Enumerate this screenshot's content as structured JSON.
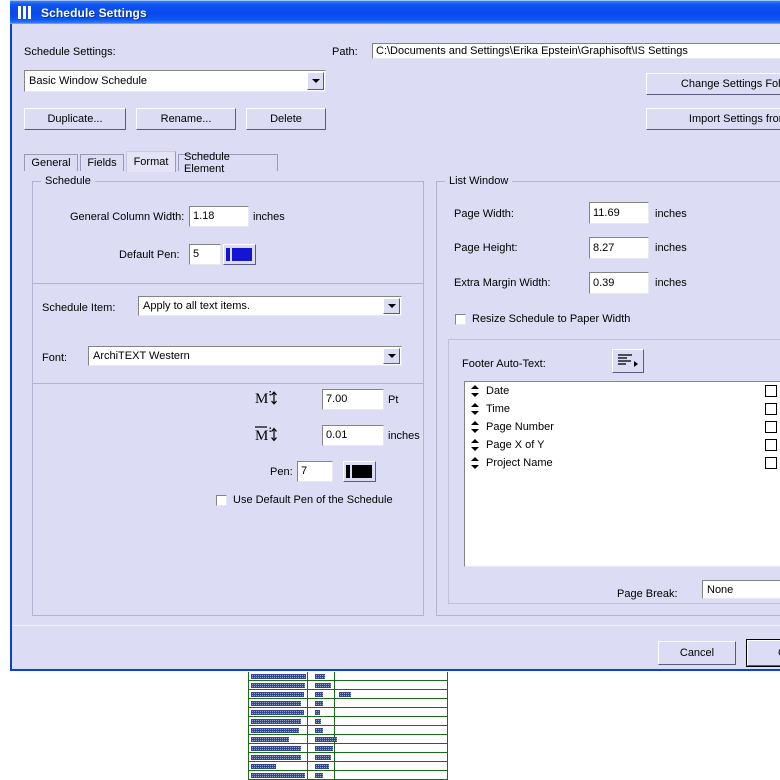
{
  "window": {
    "title": "Schedule Settings",
    "icon": "columns-icon"
  },
  "header": {
    "settings_label": "Schedule Settings:",
    "settings_value": "Basic Window Schedule",
    "path_label": "Path:",
    "path_value": "C:\\Documents and Settings\\Erika Epstein\\Graphisoft\\IS Settings",
    "buttons": {
      "duplicate": "Duplicate...",
      "rename": "Rename...",
      "delete": "Delete",
      "change_settings_folder": "Change Settings Folder...",
      "import_settings_from": "Import Settings from..."
    }
  },
  "tabs": [
    {
      "label": "General",
      "active": false
    },
    {
      "label": "Fields",
      "active": false
    },
    {
      "label": "Format",
      "active": true
    },
    {
      "label": "Schedule Element",
      "active": false
    }
  ],
  "schedule_group": {
    "title": "Schedule",
    "general_column_width_label": "General Column Width:",
    "general_column_width_value": "1.18",
    "general_column_width_unit": "inches",
    "default_pen_label": "Default Pen:",
    "default_pen_value": "5",
    "default_pen_color": "#1414d2",
    "schedule_item_label": "Schedule Item:",
    "schedule_item_value": "Apply to all text items.",
    "font_label": "Font:",
    "font_value": "ArchiTEXT Western",
    "font_size_icon": "text-size-icon",
    "font_size_value": "7.00",
    "font_size_unit": "Pt",
    "line_height_icon": "text-height-icon",
    "line_height_value": "0.01",
    "line_height_unit": "inches",
    "pen_label": "Pen:",
    "pen_value": "7",
    "pen_color": "#000000",
    "use_default_pen_label": "Use Default Pen of the Schedule",
    "use_default_pen_checked": false
  },
  "list_window_group": {
    "title": "List Window",
    "page_width_label": "Page Width:",
    "page_width_value": "11.69",
    "page_width_unit": "inches",
    "page_height_label": "Page Height:",
    "page_height_value": "8.27",
    "page_height_unit": "inches",
    "extra_margin_label": "Extra Margin Width:",
    "extra_margin_value": "0.39",
    "extra_margin_unit": "inches",
    "resize_label": "Resize Schedule to Paper Width",
    "resize_checked": false,
    "footer_autotext_label": "Footer Auto-Text:",
    "footer_autotext_button_icon": "text-align-left-menu-icon",
    "footer_items": [
      {
        "label": "Date",
        "checked": false
      },
      {
        "label": "Time",
        "checked": false
      },
      {
        "label": "Page Number",
        "checked": false
      },
      {
        "label": "Page X of Y",
        "checked": false
      },
      {
        "label": "Project Name",
        "checked": false
      }
    ],
    "page_break_label": "Page Break:",
    "page_break_value": "None"
  },
  "footer": {
    "cancel": "Cancel",
    "ok": "OK"
  },
  "background_sheet": {
    "rows": 12,
    "description": "schedule-table"
  },
  "colors": {
    "titlebar_blue": "#0b4ef0",
    "dialog_face": "#dcdcf4",
    "dialog_border": "#0a42d2",
    "group_border": "#b4b4d2",
    "field_bg": "#ffffff",
    "table_grid_green": "#1a6b1a"
  }
}
